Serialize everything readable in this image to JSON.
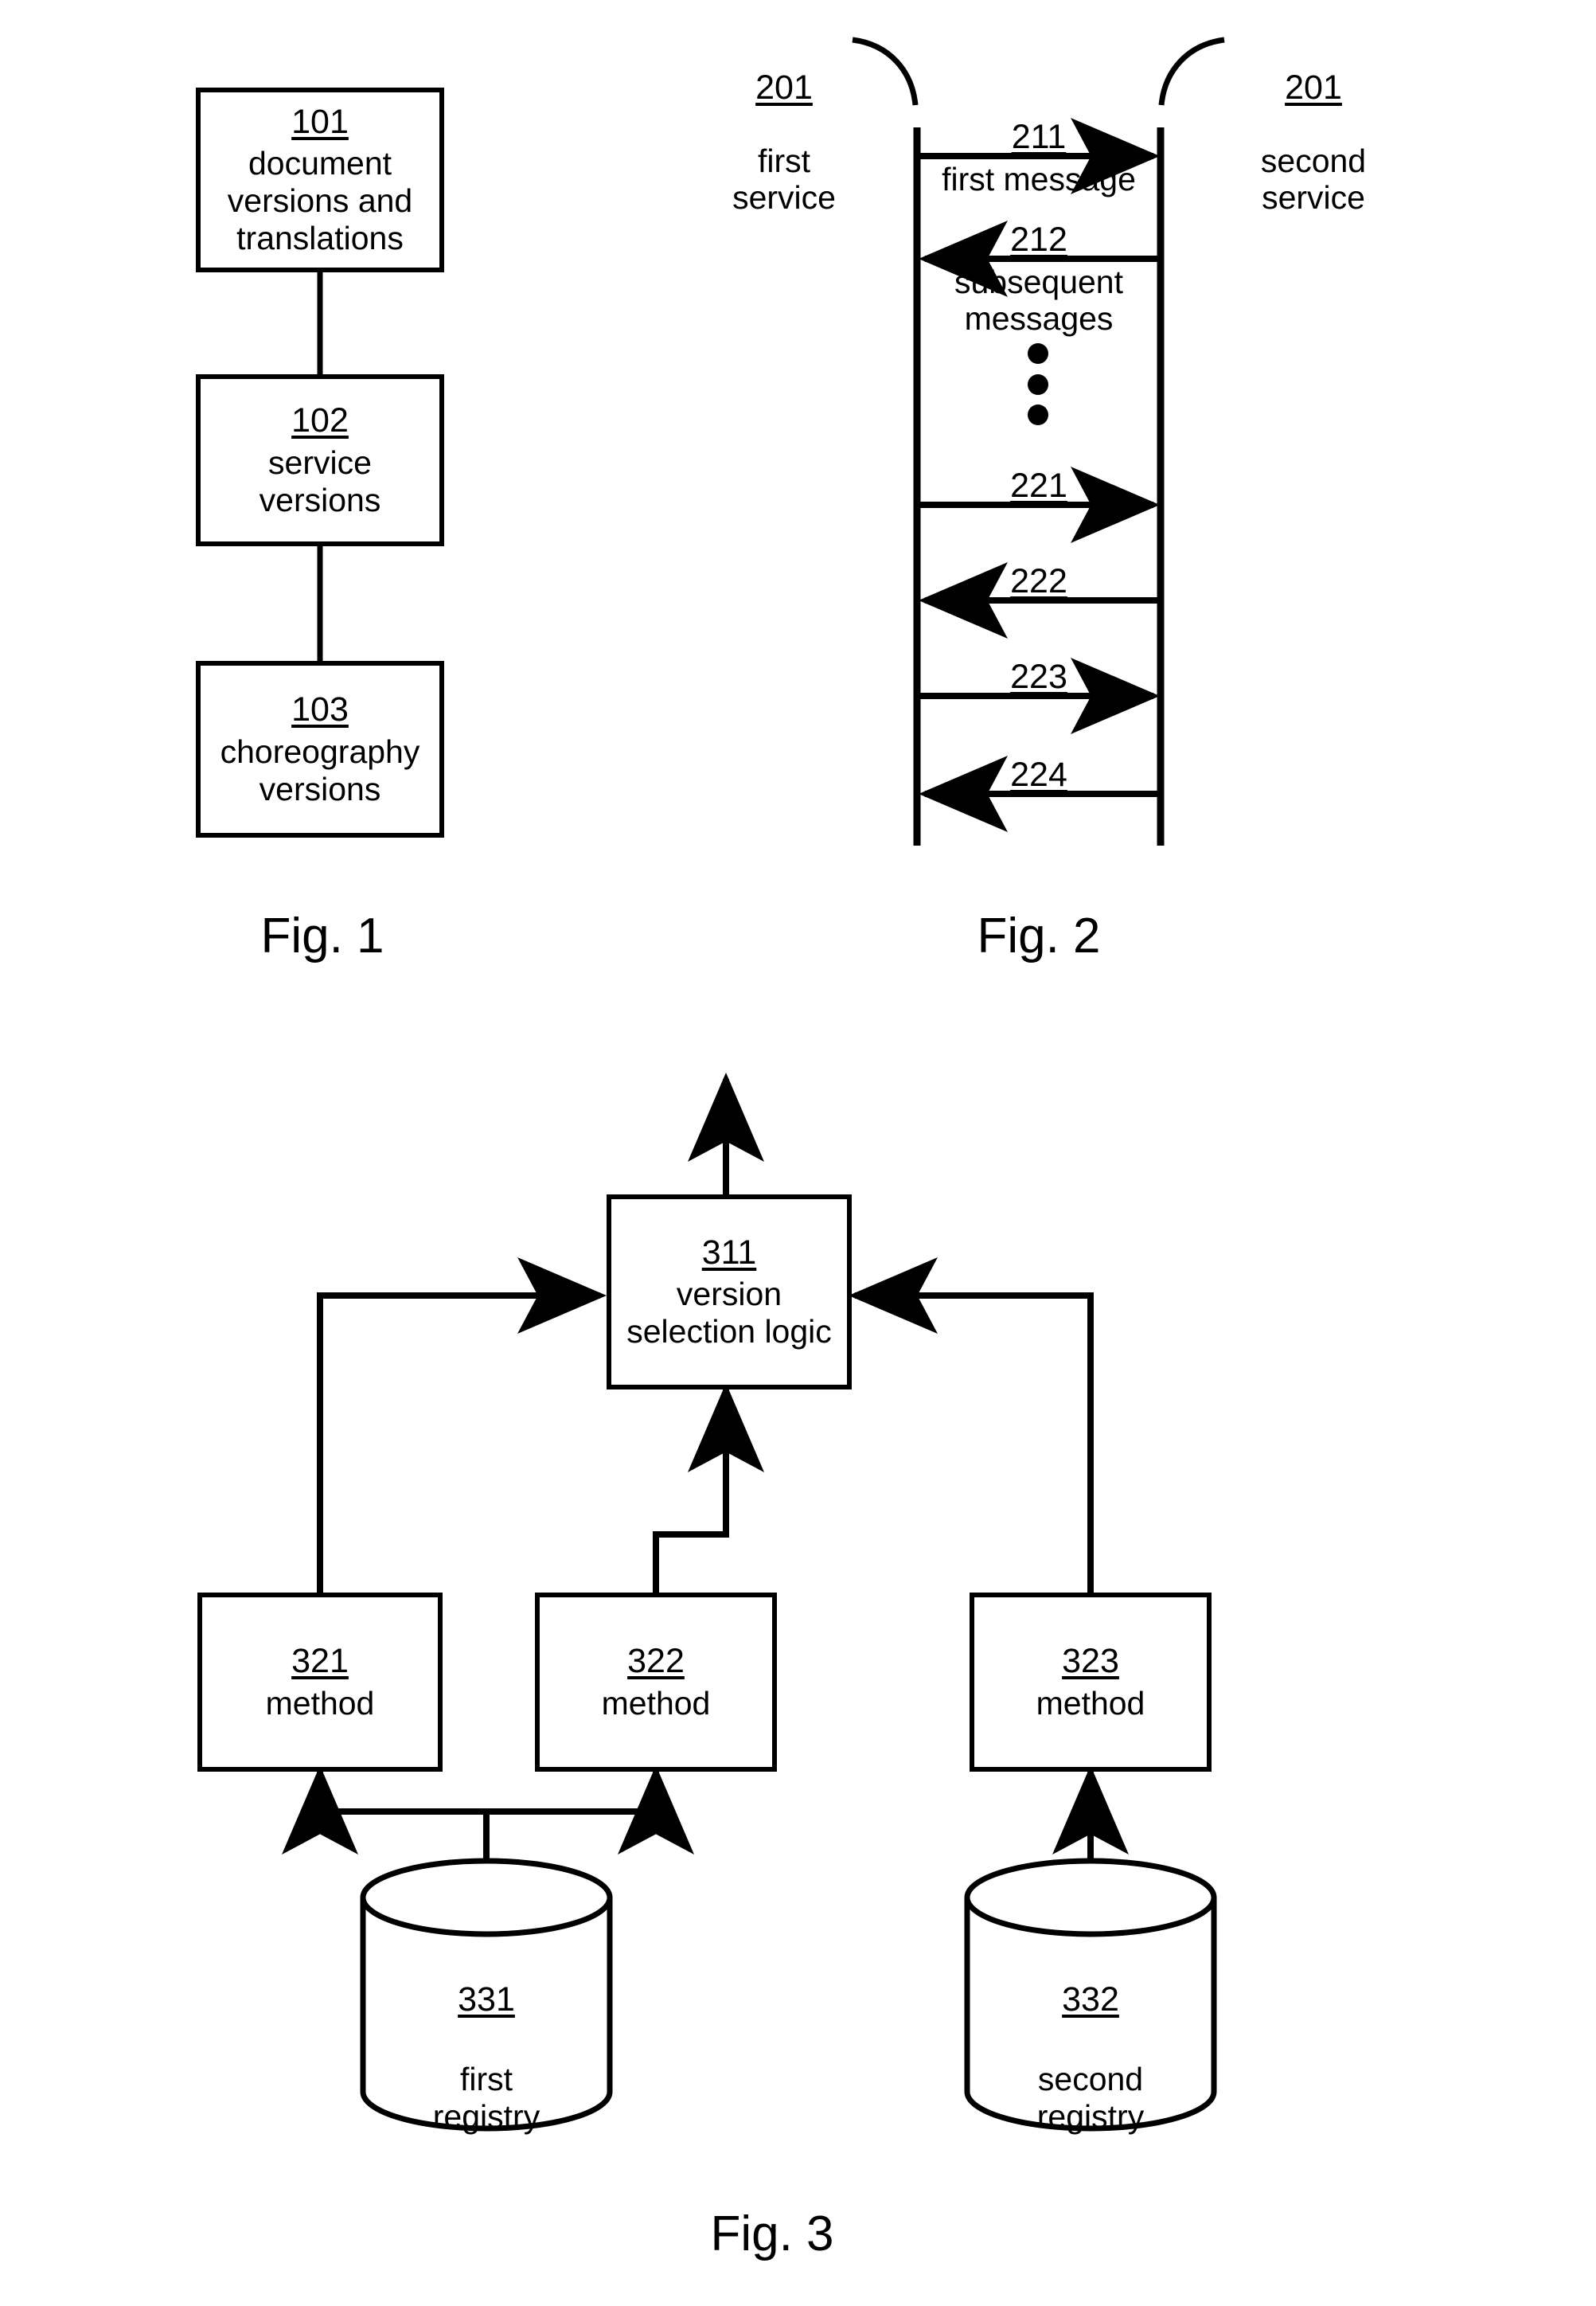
{
  "figure1": {
    "caption": "Fig. 1",
    "boxes": [
      {
        "ref": "101",
        "label": "document\nversions and\ntranslations"
      },
      {
        "ref": "102",
        "label": "service\nversions"
      },
      {
        "ref": "103",
        "label": "choreography\nversions"
      }
    ]
  },
  "figure2": {
    "caption": "Fig. 2",
    "actors": [
      {
        "ref": "201",
        "label": "first\nservice"
      },
      {
        "ref": "201",
        "label": "second\nservice"
      }
    ],
    "messages": [
      {
        "ref": "211",
        "label": "first message",
        "direction": "right"
      },
      {
        "ref": "212",
        "label": "subsequent\nmessages",
        "direction": "left"
      },
      {
        "ref": "221",
        "label": "",
        "direction": "right"
      },
      {
        "ref": "222",
        "label": "",
        "direction": "left"
      },
      {
        "ref": "223",
        "label": "",
        "direction": "right"
      },
      {
        "ref": "224",
        "label": "",
        "direction": "left"
      }
    ],
    "ellipsis": "vertical-dots"
  },
  "figure3": {
    "caption": "Fig. 3",
    "boxes": [
      {
        "ref": "311",
        "label": "version\nselection logic"
      },
      {
        "ref": "321",
        "label": "method"
      },
      {
        "ref": "322",
        "label": "method"
      },
      {
        "ref": "323",
        "label": "method"
      }
    ],
    "cylinders": [
      {
        "ref": "331",
        "label": "first\nregistry"
      },
      {
        "ref": "332",
        "label": "second\nregistry"
      }
    ]
  },
  "colors": {
    "stroke": "#000000",
    "background": "#ffffff"
  }
}
